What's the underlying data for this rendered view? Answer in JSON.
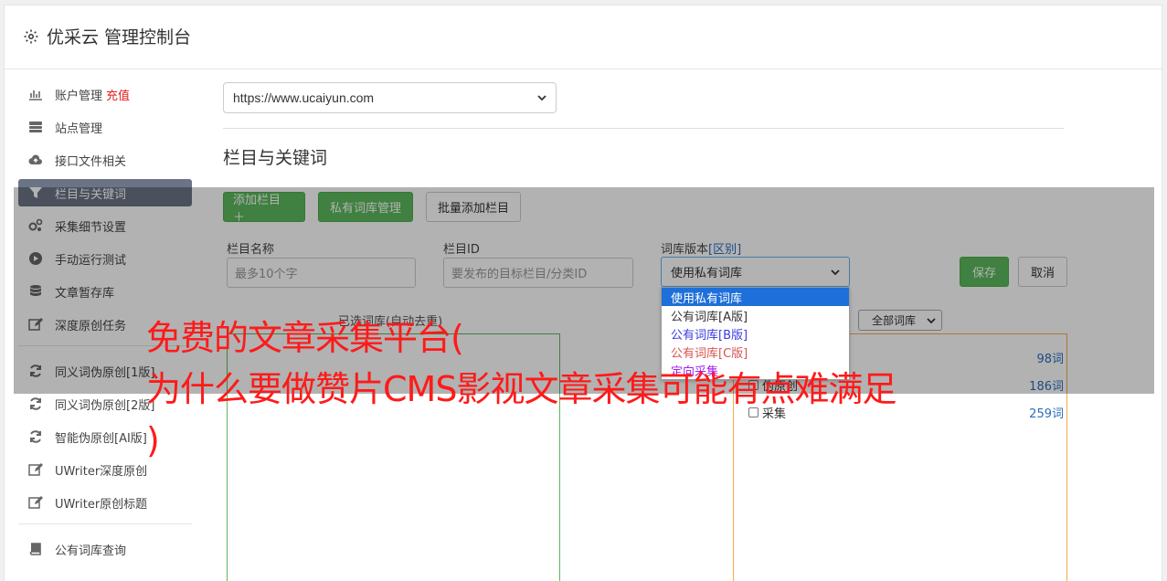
{
  "header": {
    "title": "优采云 管理控制台"
  },
  "sidebar": {
    "items": [
      {
        "label": "账户管理",
        "badge": "充值",
        "icon": "bar-chart-icon"
      },
      {
        "label": "站点管理",
        "icon": "server-icon"
      },
      {
        "label": "接口文件相关",
        "icon": "cloud-upload-icon"
      },
      {
        "label": "栏目与关键词",
        "icon": "filter-icon",
        "active": true
      },
      {
        "label": "采集细节设置",
        "icon": "gears-icon"
      },
      {
        "label": "手动运行测试",
        "icon": "play-circle-icon"
      },
      {
        "label": "文章暂存库",
        "icon": "database-icon"
      },
      {
        "label": "深度原创任务",
        "icon": "edit-icon"
      }
    ],
    "items2": [
      {
        "label": "同义词伪原创[1版]",
        "icon": "refresh-icon"
      },
      {
        "label": "同义词伪原创[2版]",
        "icon": "refresh-icon"
      },
      {
        "label": "智能伪原创[AI版]",
        "icon": "refresh-icon"
      },
      {
        "label": "UWriter深度原创",
        "icon": "edit-icon"
      },
      {
        "label": "UWriter原创标题",
        "icon": "edit-icon"
      }
    ],
    "items3": [
      {
        "label": "公有词库查询",
        "icon": "book-icon"
      }
    ]
  },
  "main": {
    "site_select": "https://www.ucaiyun.com",
    "section_title": "栏目与关键词",
    "toolbar": {
      "add_column": "添加栏目 ＋",
      "private_lib": "私有词库管理",
      "batch_add": "批量添加栏目"
    },
    "form": {
      "name_label": "栏目名称",
      "name_placeholder": "最多10个字",
      "id_label": "栏目ID",
      "id_placeholder": "要发布的目标栏目/分类ID",
      "version_label": "词库版本",
      "version_link": "[区别]",
      "version_selected": "使用私有词库",
      "save": "保存",
      "cancel": "取消"
    },
    "dropdown_options": [
      "使用私有词库",
      "公有词库[A版]",
      "公有词库[B版]",
      "公有词库[C版]",
      "定向采集"
    ],
    "dropdown_colors": [
      "#ffffff",
      "#333333",
      "#3a3adf",
      "#d9534f",
      "#a020f0"
    ],
    "left_panel_title": "已选词库(自动去重)",
    "right_filter": "全部词库",
    "keywords": [
      {
        "name": "",
        "count": "98词"
      },
      {
        "name": "伪原创",
        "count": "186词"
      },
      {
        "name": "采集",
        "count": "259词"
      }
    ]
  },
  "promo": {
    "line1": "免费的文章采集平台(",
    "line2": "为什么要做赞片CMS影视文章采集可能有点难满足",
    "line3": ")"
  },
  "colors": {
    "accent_red": "#ff1a1a",
    "active_nav": "#6b7486",
    "green": "#5cb85c"
  }
}
